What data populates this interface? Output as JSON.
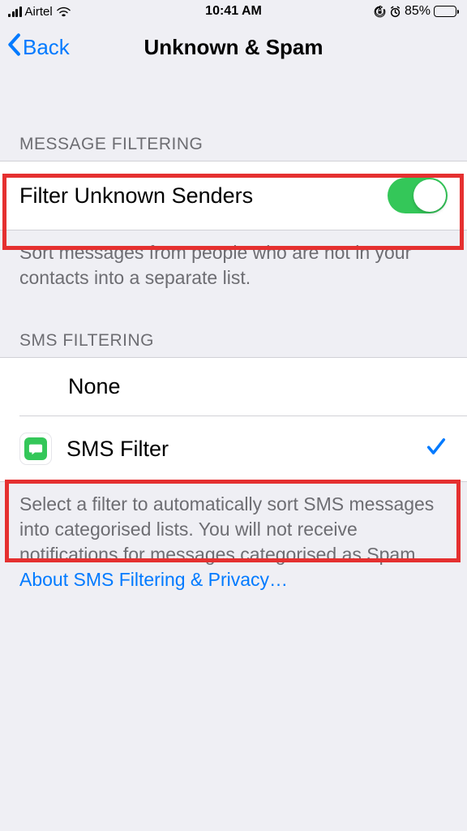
{
  "status_bar": {
    "carrier": "Airtel",
    "time": "10:41 AM",
    "battery_pct": "85%"
  },
  "nav": {
    "back_label": "Back",
    "title": "Unknown & Spam"
  },
  "message_filtering": {
    "header": "MESSAGE FILTERING",
    "cell_label": "Filter Unknown Senders",
    "footer": "Sort messages from people who are not in your contacts into a separate list."
  },
  "sms_filtering": {
    "header": "SMS FILTERING",
    "options": [
      {
        "label": "None",
        "selected": false,
        "icon": null
      },
      {
        "label": "SMS Filter",
        "selected": true,
        "icon": "sms-app-icon"
      }
    ],
    "footer_text": "Select a filter to automatically sort SMS messages into categorised lists. You will not receive notifications for messages categorised as Spam.",
    "footer_link": "About SMS Filtering & Privacy…"
  }
}
